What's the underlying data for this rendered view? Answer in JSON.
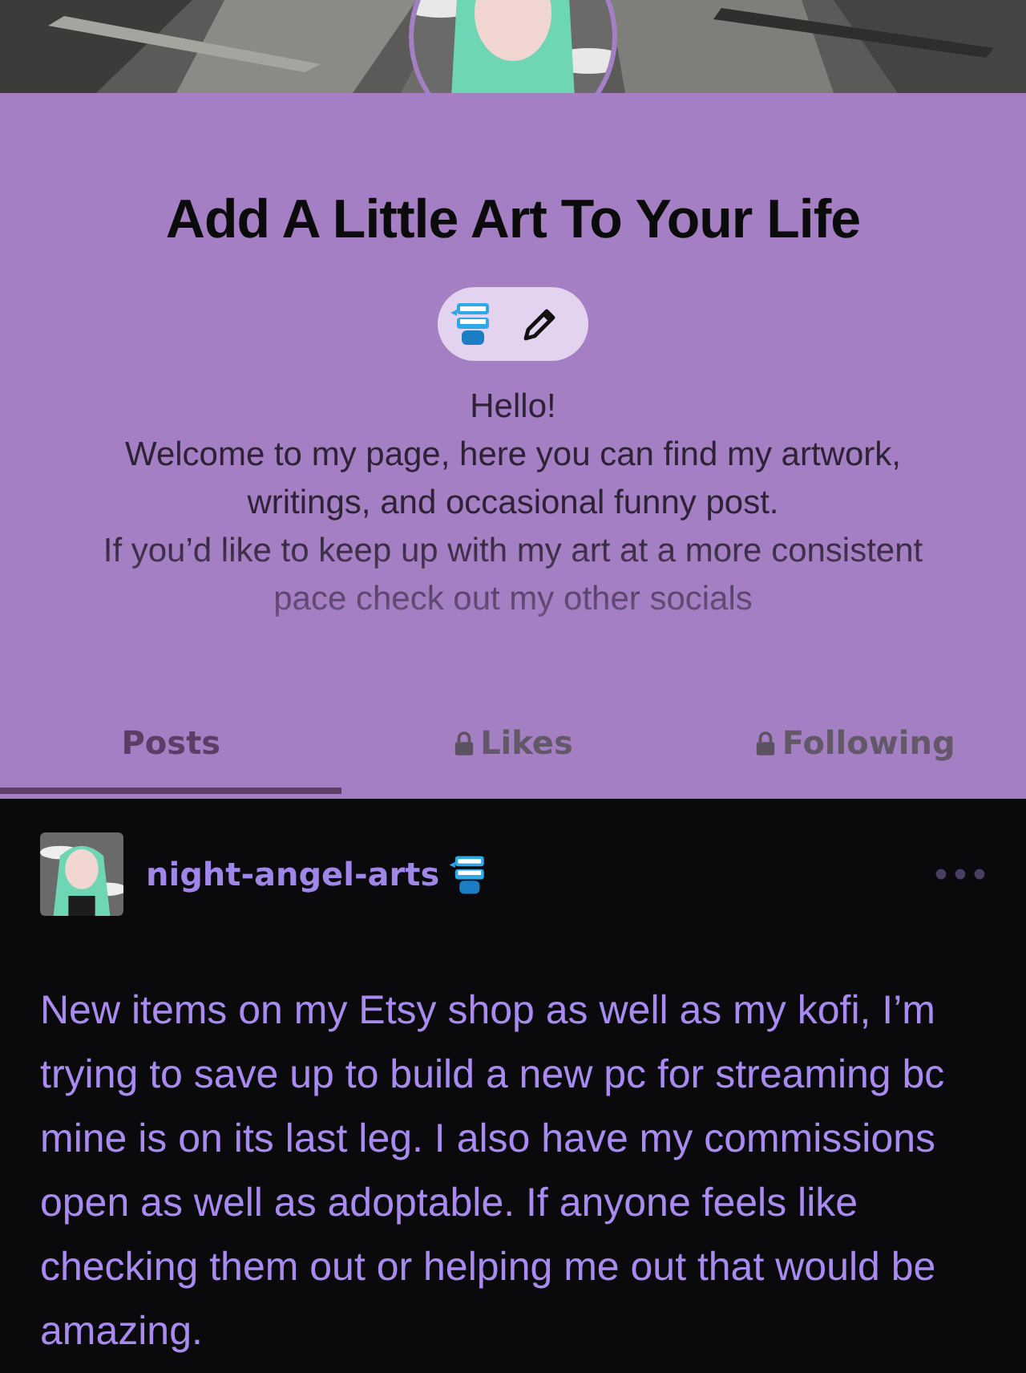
{
  "blog": {
    "title": "Add A Little Art To Your Life",
    "description": [
      "Hello!",
      "Welcome to my page, here you can find my artwork, writings, and occasional funny post.",
      "If you’d like to keep up with my art at a more consistent pace check out my other socials"
    ]
  },
  "tabs": [
    {
      "label": "Posts",
      "selected": true,
      "locked": false
    },
    {
      "label": "Likes",
      "selected": false,
      "locked": true
    },
    {
      "label": "Following",
      "selected": false,
      "locked": true
    }
  ],
  "post": {
    "author": "night-angel-arts",
    "text": "New items on my Etsy shop as well as my kofi, I’m trying to save up to build a new pc for streaming bc mine is on its last leg. I also have my commissions open as well as adoptable. If anyone feels like checking them out or helping me out that would be amazing."
  }
}
